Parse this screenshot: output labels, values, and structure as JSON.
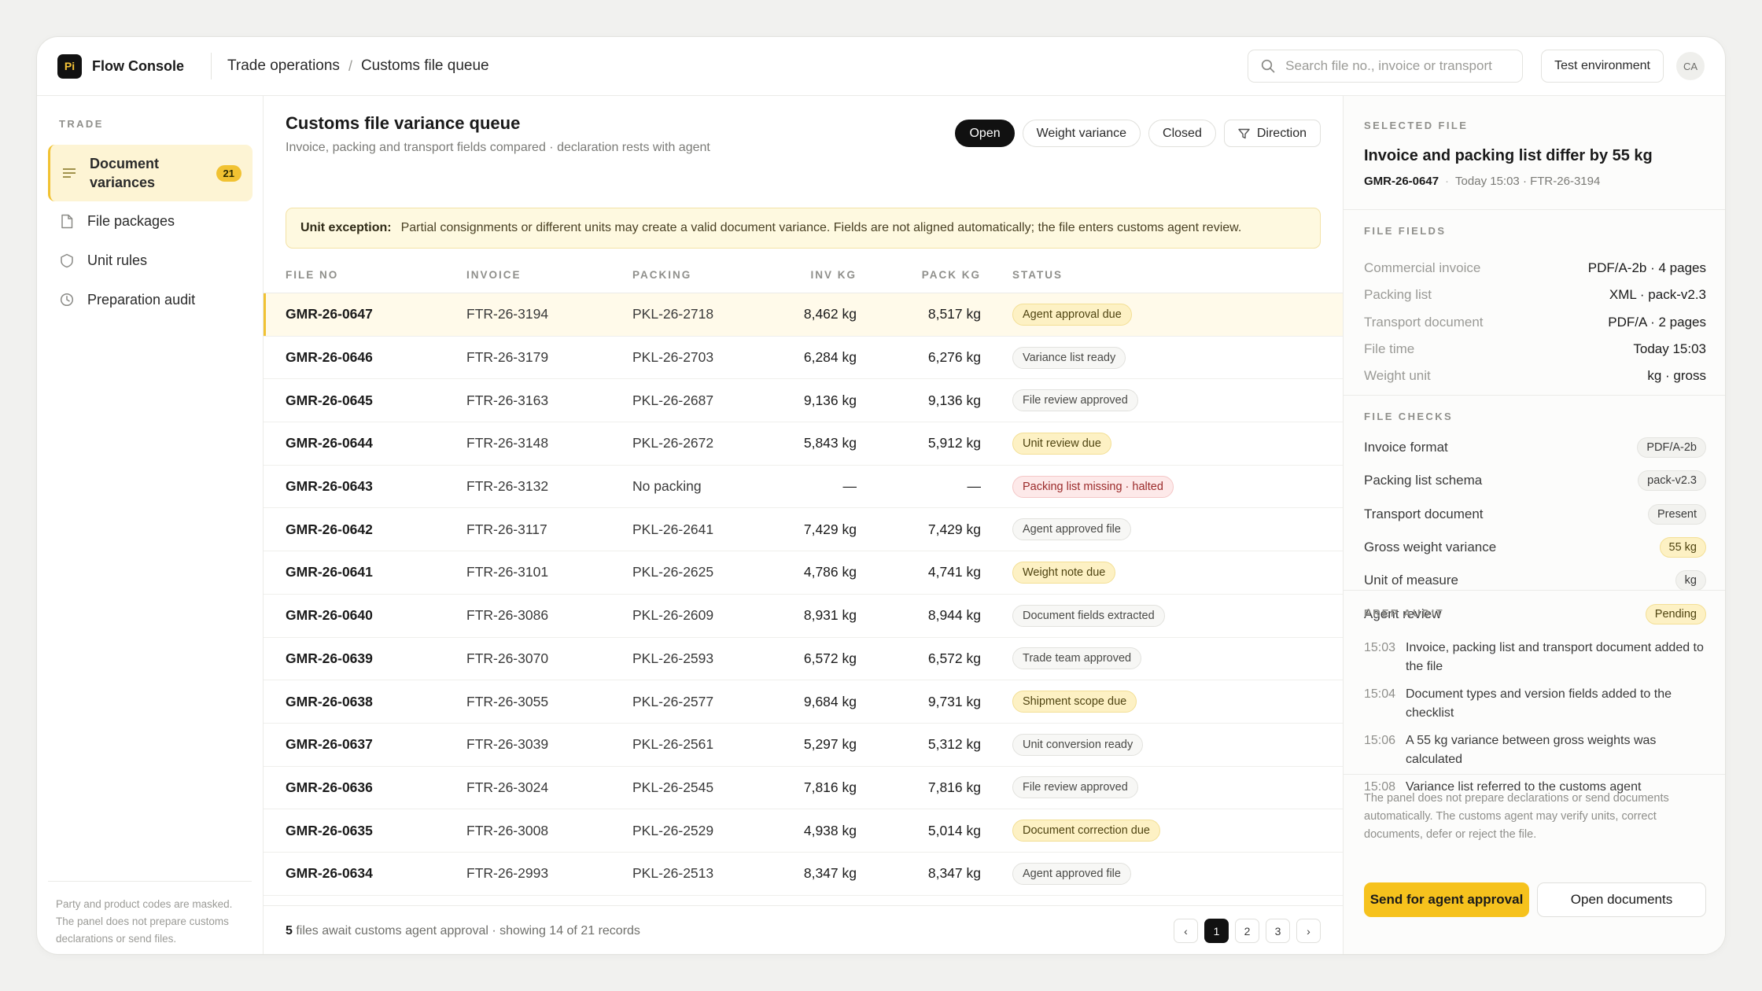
{
  "app": {
    "logo": "Pi",
    "title": "Flow Console"
  },
  "breadcrumb": [
    "Trade operations",
    "Customs file queue"
  ],
  "search": {
    "placeholder": "Search file no., invoice or transport"
  },
  "environment": "Test environment",
  "avatar": "CA",
  "sidebar": {
    "section": "TRADE",
    "items": [
      {
        "label": "Document variances",
        "count": "21",
        "icon": "list-icon"
      },
      {
        "label": "File packages",
        "icon": "file-icon"
      },
      {
        "label": "Unit rules",
        "icon": "shield-icon"
      },
      {
        "label": "Preparation audit",
        "icon": "clock-icon"
      }
    ],
    "footer": "Party and product codes are masked. The panel does not prepare customs declarations or send files."
  },
  "main": {
    "title": "Customs file variance queue",
    "subtitle": "Invoice, packing and transport fields compared · declaration rests with agent",
    "filters": [
      "Open",
      "Weight variance",
      "Closed",
      "Direction"
    ],
    "alert": {
      "label": "Unit exception:",
      "text": "Partial consignments or different units may create a valid document variance. Fields are not aligned automatically; the file enters customs agent review."
    },
    "columns": [
      "FILE NO",
      "INVOICE",
      "PACKING",
      "INV KG",
      "PACK KG",
      "STATUS"
    ],
    "rows": [
      {
        "file": "GMR-26-0647",
        "invoice": "FTR-26-3194",
        "packing": "PKL-26-2718",
        "inv": "8,462 kg",
        "pack": "8,517 kg",
        "status": "Agent approval due",
        "tone": "warn"
      },
      {
        "file": "GMR-26-0646",
        "invoice": "FTR-26-3179",
        "packing": "PKL-26-2703",
        "inv": "6,284 kg",
        "pack": "6,276 kg",
        "status": "Variance list ready",
        "tone": "neutral"
      },
      {
        "file": "GMR-26-0645",
        "invoice": "FTR-26-3163",
        "packing": "PKL-26-2687",
        "inv": "9,136 kg",
        "pack": "9,136 kg",
        "status": "File review approved",
        "tone": "neutral"
      },
      {
        "file": "GMR-26-0644",
        "invoice": "FTR-26-3148",
        "packing": "PKL-26-2672",
        "inv": "5,843 kg",
        "pack": "5,912 kg",
        "status": "Unit review due",
        "tone": "warn"
      },
      {
        "file": "GMR-26-0643",
        "invoice": "FTR-26-3132",
        "packing": "No packing",
        "inv": "—",
        "pack": "—",
        "status": "Packing list missing · halted",
        "tone": "bad"
      },
      {
        "file": "GMR-26-0642",
        "invoice": "FTR-26-3117",
        "packing": "PKL-26-2641",
        "inv": "7,429 kg",
        "pack": "7,429 kg",
        "status": "Agent approved file",
        "tone": "neutral"
      },
      {
        "file": "GMR-26-0641",
        "invoice": "FTR-26-3101",
        "packing": "PKL-26-2625",
        "inv": "4,786 kg",
        "pack": "4,741 kg",
        "status": "Weight note due",
        "tone": "warn"
      },
      {
        "file": "GMR-26-0640",
        "invoice": "FTR-26-3086",
        "packing": "PKL-26-2609",
        "inv": "8,931 kg",
        "pack": "8,944 kg",
        "status": "Document fields extracted",
        "tone": "neutral"
      },
      {
        "file": "GMR-26-0639",
        "invoice": "FTR-26-3070",
        "packing": "PKL-26-2593",
        "inv": "6,572 kg",
        "pack": "6,572 kg",
        "status": "Trade team approved",
        "tone": "neutral"
      },
      {
        "file": "GMR-26-0638",
        "invoice": "FTR-26-3055",
        "packing": "PKL-26-2577",
        "inv": "9,684 kg",
        "pack": "9,731 kg",
        "status": "Shipment scope due",
        "tone": "warn"
      },
      {
        "file": "GMR-26-0637",
        "invoice": "FTR-26-3039",
        "packing": "PKL-26-2561",
        "inv": "5,297 kg",
        "pack": "5,312 kg",
        "status": "Unit conversion ready",
        "tone": "neutral"
      },
      {
        "file": "GMR-26-0636",
        "invoice": "FTR-26-3024",
        "packing": "PKL-26-2545",
        "inv": "7,816 kg",
        "pack": "7,816 kg",
        "status": "File review approved",
        "tone": "neutral"
      },
      {
        "file": "GMR-26-0635",
        "invoice": "FTR-26-3008",
        "packing": "PKL-26-2529",
        "inv": "4,938 kg",
        "pack": "5,014 kg",
        "status": "Document correction due",
        "tone": "warn"
      },
      {
        "file": "GMR-26-0634",
        "invoice": "FTR-26-2993",
        "packing": "PKL-26-2513",
        "inv": "8,347 kg",
        "pack": "8,347 kg",
        "status": "Agent approved file",
        "tone": "neutral"
      }
    ],
    "footer": {
      "count": "5",
      "text": " files await customs agent approval · showing 14 of 21 records"
    },
    "pager": [
      "‹",
      "1",
      "2",
      "3",
      "›"
    ],
    "current_page": "1"
  },
  "panel": {
    "label": "SELECTED FILE",
    "title": "Invoice and packing list differ by 55 kg",
    "file_no": "GMR-26-0647",
    "meta": "Today 15:03 · FTR-26-3194",
    "fields_label": "FILE FIELDS",
    "fields": [
      {
        "key": "Commercial invoice",
        "value": "PDF/A-2b · 4 pages"
      },
      {
        "key": "Packing list",
        "value": "XML · pack-v2.3"
      },
      {
        "key": "Transport document",
        "value": "PDF/A · 2 pages"
      },
      {
        "key": "File time",
        "value": "Today 15:03"
      },
      {
        "key": "Weight unit",
        "value": "kg · gross"
      }
    ],
    "checks_label": "FILE CHECKS",
    "checks": [
      {
        "key": "Invoice format",
        "value": "PDF/A-2b",
        "tone": "neutral"
      },
      {
        "key": "Packing list schema",
        "value": "pack-v2.3",
        "tone": "neutral"
      },
      {
        "key": "Transport document",
        "value": "Present",
        "tone": "neutral"
      },
      {
        "key": "Gross weight variance",
        "value": "55 kg",
        "tone": "warn"
      },
      {
        "key": "Unit of measure",
        "value": "kg",
        "tone": "neutral"
      },
      {
        "key": "Agent review",
        "value": "Pending",
        "tone": "warn"
      }
    ],
    "audit_label": "PREP AUDIT",
    "audit": [
      {
        "time": "15:03",
        "text": "Invoice, packing list and transport document added to the file"
      },
      {
        "time": "15:04",
        "text": "Document types and version fields added to the checklist"
      },
      {
        "time": "15:06",
        "text": "A 55 kg variance between gross weights was calculated"
      },
      {
        "time": "15:08",
        "text": "Variance list referred to the customs agent"
      }
    ],
    "note": "The panel does not prepare declarations or send documents automatically. The customs agent may verify units, correct documents, defer or reject the file.",
    "primary_action": "Send for agent approval",
    "secondary_action": "Open documents"
  },
  "colors": {
    "accent": "#f1c232",
    "warn_bg": "#fdf1c4",
    "bad_text": "#9b2a2a"
  }
}
